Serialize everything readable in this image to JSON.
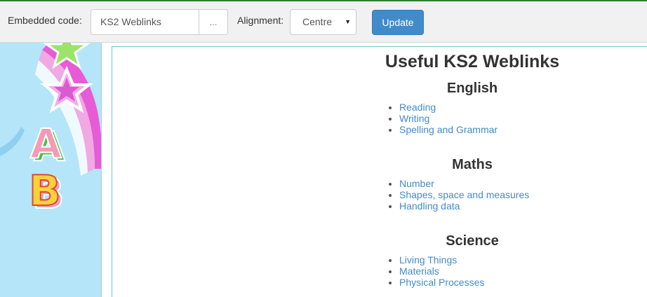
{
  "toolbar": {
    "embed_label": "Embedded code:",
    "embed_value": "KS2 Weblinks",
    "browse_label": "...",
    "align_label": "Alignment:",
    "align_value": "Centre",
    "update_label": "Update"
  },
  "colors": {
    "accent": "#428bca",
    "toolbar_bg": "#f1f1f1",
    "strip_bg": "#b5e5f9",
    "top_border": "#2e7d32"
  },
  "decoration": {
    "letters": [
      "A",
      "B"
    ],
    "icons": [
      "star-icon",
      "star-icon"
    ]
  },
  "page": {
    "title": "Useful KS2 Weblinks",
    "sections": [
      {
        "heading": "English",
        "links": [
          "Reading",
          "Writing",
          "Spelling and Grammar"
        ]
      },
      {
        "heading": "Maths",
        "links": [
          "Number",
          "Shapes, space and measures",
          "Handling data"
        ]
      },
      {
        "heading": "Science",
        "links": [
          "Living Things",
          "Materials",
          "Physical Processes"
        ]
      }
    ]
  }
}
